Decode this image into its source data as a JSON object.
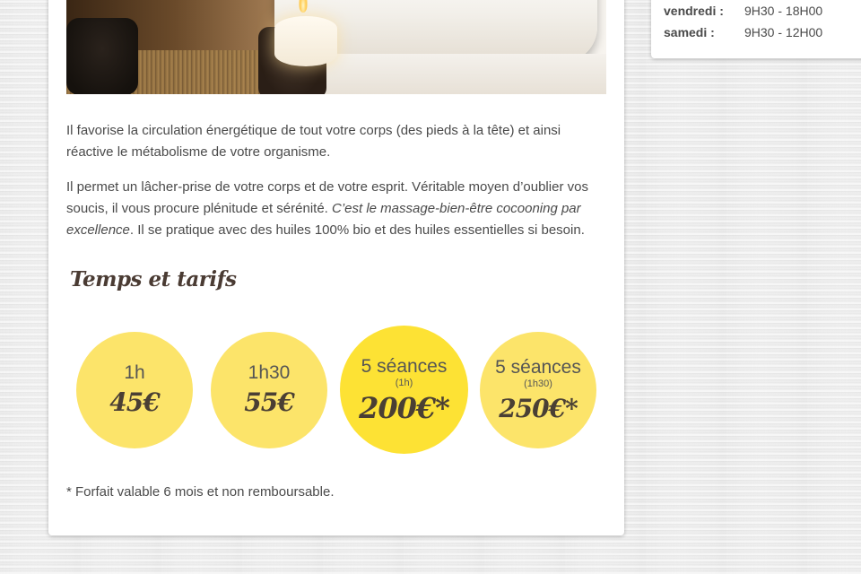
{
  "content": {
    "paragraph1": "Il favorise la circulation énergétique de tout votre corps (des pieds à la tête) et ainsi réactive le métabolisme de votre organisme.",
    "paragraph2_start": "Il permet un lâcher-prise de votre corps et de votre esprit. Véritable moyen d’oublier vos soucis, il vous procure plénitude et sérénité. ",
    "paragraph2_emphasis": "C’est le massage-bien-être cocooning par excellence",
    "paragraph2_end": ". Il se pratique avec des huiles 100% bio et des huiles essentielles si besoin.",
    "section_title": "Temps et tarifs",
    "footnote": "* Forfait valable 6 mois et non remboursable."
  },
  "pricing": [
    {
      "duration": "1h",
      "sub": "",
      "price": "45€"
    },
    {
      "duration": "1h30",
      "sub": "",
      "price": "55€"
    },
    {
      "duration": "5 séances",
      "sub": "(1h)",
      "price": "200€*"
    },
    {
      "duration": "5 séances",
      "sub": "(1h30)",
      "price": "250€*"
    }
  ],
  "hours": [
    {
      "day": "vendredi :",
      "time": "9H30 - 18H00"
    },
    {
      "day": "samedi :",
      "time": "9H30 - 12H00"
    }
  ],
  "colors": {
    "circle": "#fce46a",
    "circle_featured": "#fde234",
    "text": "#4a4a4a"
  }
}
